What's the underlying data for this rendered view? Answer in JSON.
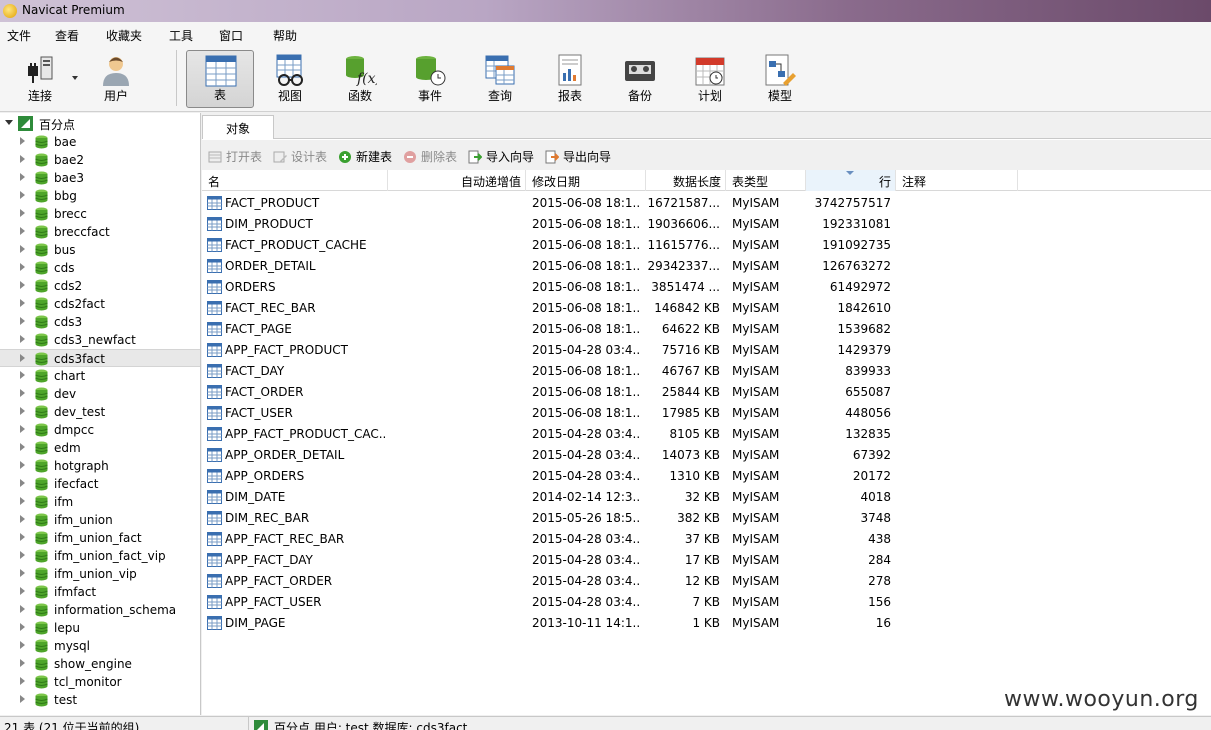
{
  "window": {
    "title": "Navicat Premium"
  },
  "menu": [
    "文件",
    "查看",
    "收藏夹",
    "工具",
    "窗口",
    "帮助"
  ],
  "toolbar": {
    "connect": "连接",
    "user": "用户",
    "buttons": [
      "表",
      "视图",
      "函数",
      "事件",
      "查询",
      "报表",
      "备份",
      "计划",
      "模型"
    ]
  },
  "sidebar": {
    "root": "百分点",
    "databases": [
      "bae",
      "bae2",
      "bae3",
      "bbg",
      "brecc",
      "breccfact",
      "bus",
      "cds",
      "cds2",
      "cds2fact",
      "cds3",
      "cds3_newfact",
      "cds3fact",
      "chart",
      "dev",
      "dev_test",
      "dmpcc",
      "edm",
      "hotgraph",
      "ifecfact",
      "ifm",
      "ifm_union",
      "ifm_union_fact",
      "ifm_union_fact_vip",
      "ifm_union_vip",
      "ifmfact",
      "information_schema",
      "lepu",
      "mysql",
      "show_engine",
      "tcl_monitor",
      "test"
    ],
    "selected": "cds3fact"
  },
  "tab": {
    "label": "对象"
  },
  "objbar": {
    "open": "打开表",
    "design": "设计表",
    "new": "新建表",
    "delete": "删除表",
    "import": "导入向导",
    "export": "导出向导"
  },
  "columns": {
    "name": "名",
    "auto_inc": "自动递增值",
    "modified": "修改日期",
    "data_length": "数据长度",
    "type": "表类型",
    "rows": "行",
    "comment": "注释"
  },
  "tables": [
    {
      "name": "FACT_PRODUCT",
      "modified": "2015-06-08 18:1...",
      "size": "16721587...",
      "type": "MyISAM",
      "rows": "3742757517"
    },
    {
      "name": "DIM_PRODUCT",
      "modified": "2015-06-08 18:1...",
      "size": "19036606...",
      "type": "MyISAM",
      "rows": "192331081"
    },
    {
      "name": "FACT_PRODUCT_CACHE",
      "modified": "2015-06-08 18:1...",
      "size": "11615776...",
      "type": "MyISAM",
      "rows": "191092735"
    },
    {
      "name": "ORDER_DETAIL",
      "modified": "2015-06-08 18:1...",
      "size": "29342337...",
      "type": "MyISAM",
      "rows": "126763272"
    },
    {
      "name": "ORDERS",
      "modified": "2015-06-08 18:1...",
      "size": "3851474 ...",
      "type": "MyISAM",
      "rows": "61492972"
    },
    {
      "name": "FACT_REC_BAR",
      "modified": "2015-06-08 18:1...",
      "size": "146842 KB",
      "type": "MyISAM",
      "rows": "1842610"
    },
    {
      "name": "FACT_PAGE",
      "modified": "2015-06-08 18:1...",
      "size": "64622 KB",
      "type": "MyISAM",
      "rows": "1539682"
    },
    {
      "name": "APP_FACT_PRODUCT",
      "modified": "2015-04-28 03:4...",
      "size": "75716 KB",
      "type": "MyISAM",
      "rows": "1429379"
    },
    {
      "name": "FACT_DAY",
      "modified": "2015-06-08 18:1...",
      "size": "46767 KB",
      "type": "MyISAM",
      "rows": "839933"
    },
    {
      "name": "FACT_ORDER",
      "modified": "2015-06-08 18:1...",
      "size": "25844 KB",
      "type": "MyISAM",
      "rows": "655087"
    },
    {
      "name": "FACT_USER",
      "modified": "2015-06-08 18:1...",
      "size": "17985 KB",
      "type": "MyISAM",
      "rows": "448056"
    },
    {
      "name": "APP_FACT_PRODUCT_CAC...",
      "modified": "2015-04-28 03:4...",
      "size": "8105 KB",
      "type": "MyISAM",
      "rows": "132835"
    },
    {
      "name": "APP_ORDER_DETAIL",
      "modified": "2015-04-28 03:4...",
      "size": "14073 KB",
      "type": "MyISAM",
      "rows": "67392"
    },
    {
      "name": "APP_ORDERS",
      "modified": "2015-04-28 03:4...",
      "size": "1310 KB",
      "type": "MyISAM",
      "rows": "20172"
    },
    {
      "name": "DIM_DATE",
      "modified": "2014-02-14 12:3...",
      "size": "32 KB",
      "type": "MyISAM",
      "rows": "4018"
    },
    {
      "name": "DIM_REC_BAR",
      "modified": "2015-05-26 18:5...",
      "size": "382 KB",
      "type": "MyISAM",
      "rows": "3748"
    },
    {
      "name": "APP_FACT_REC_BAR",
      "modified": "2015-04-28 03:4...",
      "size": "37 KB",
      "type": "MyISAM",
      "rows": "438"
    },
    {
      "name": "APP_FACT_DAY",
      "modified": "2015-04-28 03:4...",
      "size": "17 KB",
      "type": "MyISAM",
      "rows": "284"
    },
    {
      "name": "APP_FACT_ORDER",
      "modified": "2015-04-28 03:4...",
      "size": "12 KB",
      "type": "MyISAM",
      "rows": "278"
    },
    {
      "name": "APP_FACT_USER",
      "modified": "2015-04-28 03:4...",
      "size": "7 KB",
      "type": "MyISAM",
      "rows": "156"
    },
    {
      "name": "DIM_PAGE",
      "modified": "2013-10-11 14:1...",
      "size": "1 KB",
      "type": "MyISAM",
      "rows": "16"
    }
  ],
  "status": {
    "left": "21 表 (21 位于当前的组)",
    "right": "百分点   用户: test   数据库: cds3fact"
  },
  "watermark": "www.wooyun.org"
}
